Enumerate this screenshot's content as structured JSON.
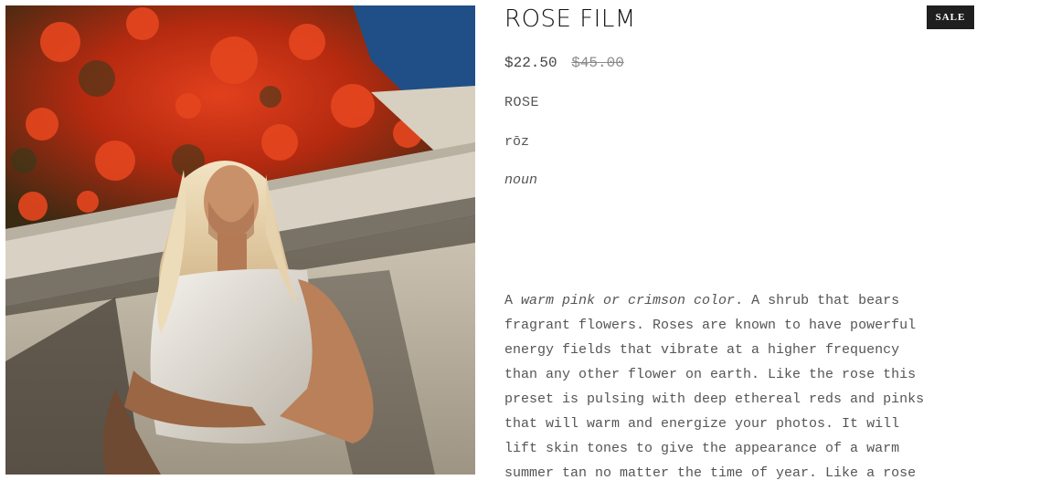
{
  "product": {
    "title": "ROSE FILM",
    "badge": "SALE",
    "price_sale": "$22.50",
    "price_original": "$45.00",
    "image_alt": "Woman with blonde hair in a white t-shirt leaning against a wall under red bougainvillea"
  },
  "definition": {
    "word": "ROSE",
    "pronunciation": "rōz",
    "part_of_speech": "noun"
  },
  "description": {
    "l1_prefix": "A ",
    "l1_italic": "warm pink or crimson color",
    "l1_suffix": ". A shrub that bears",
    "l2": "fragrant flowers. Roses are known to have powerful",
    "l3": "energy fields that vibrate at a higher frequency",
    "l4": "than any other flower on earth. Like the rose this",
    "l5": "preset is pulsing with deep ethereal reds and pinks",
    "l6": "that will warm and energize your photos. It will",
    "l7": "lift skin tones to give the appearance of a warm",
    "l8": "summer tan no matter the time of year. Like a rose"
  },
  "colors": {
    "badge_bg": "#1f1f1f",
    "text": "#555555",
    "strike_price": "#8a8a8a"
  }
}
